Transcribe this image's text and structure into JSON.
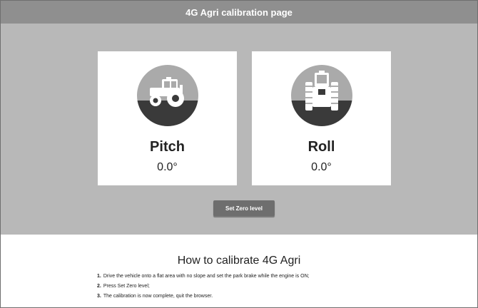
{
  "title": "4G Agri calibration page",
  "pitch": {
    "label": "Pitch",
    "value": "0.0°",
    "icon": "tractor-side-icon"
  },
  "roll": {
    "label": "Roll",
    "value": "0.0°",
    "icon": "tractor-front-icon"
  },
  "set_zero_label": "Set Zero level",
  "howto": {
    "title": "How to calibrate 4G Agri",
    "steps": [
      {
        "num": "1.",
        "text": "Drive the vehicle onto a flat area with no slope and set the park brake while the engine is ON;"
      },
      {
        "num": "2.",
        "text": "Press Set Zero level;"
      },
      {
        "num": "3.",
        "text": "The calibration is now complete, quit the browser."
      }
    ]
  },
  "colors": {
    "titlebar": "#8f8f8f",
    "panel": "#b8b8b8",
    "button": "#6e6e6e",
    "icon_sky": "#aaaaaa",
    "icon_ground": "#3a3a3a"
  }
}
